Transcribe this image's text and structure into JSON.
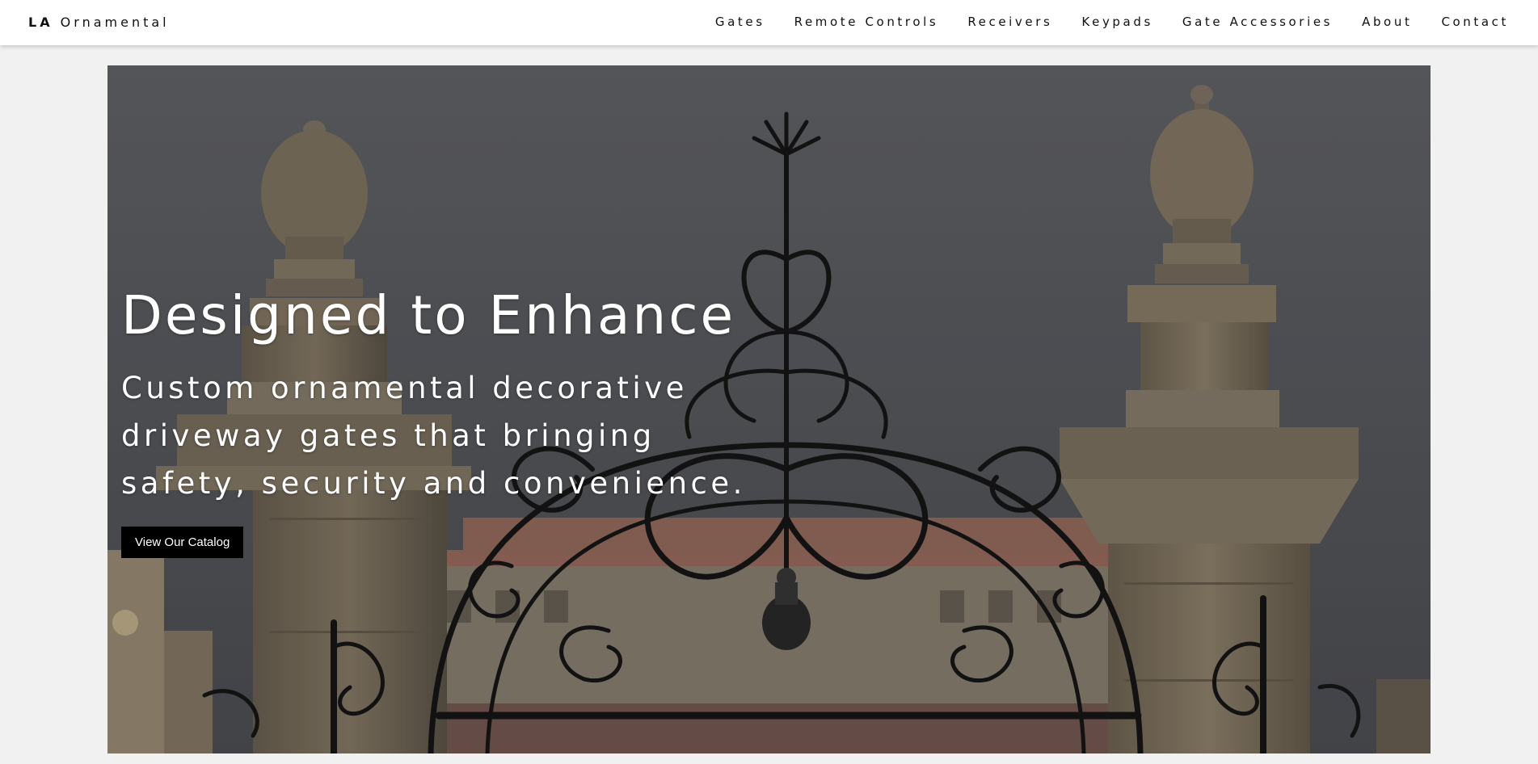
{
  "header": {
    "brand_bold": "LA",
    "brand_rest": "Ornamental",
    "nav": [
      "Gates",
      "Remote Controls",
      "Receivers",
      "Keypads",
      "Gate Accessories",
      "About",
      "Contact"
    ]
  },
  "hero": {
    "title": "Designed to Enhance",
    "subtitle": "Custom ornamental decorative driveway gates that bringing safety, security and convenience.",
    "cta_label": "View Our Catalog",
    "image_subject": "ornamental wrought-iron gate between stone pillars with finials",
    "colors": {
      "sky": "#5c5e63",
      "stone": "#9c8d76",
      "iron": "#1b1b1b",
      "roof_tile": "#b37a6a",
      "button": "#000000",
      "text": "#ffffff"
    }
  }
}
